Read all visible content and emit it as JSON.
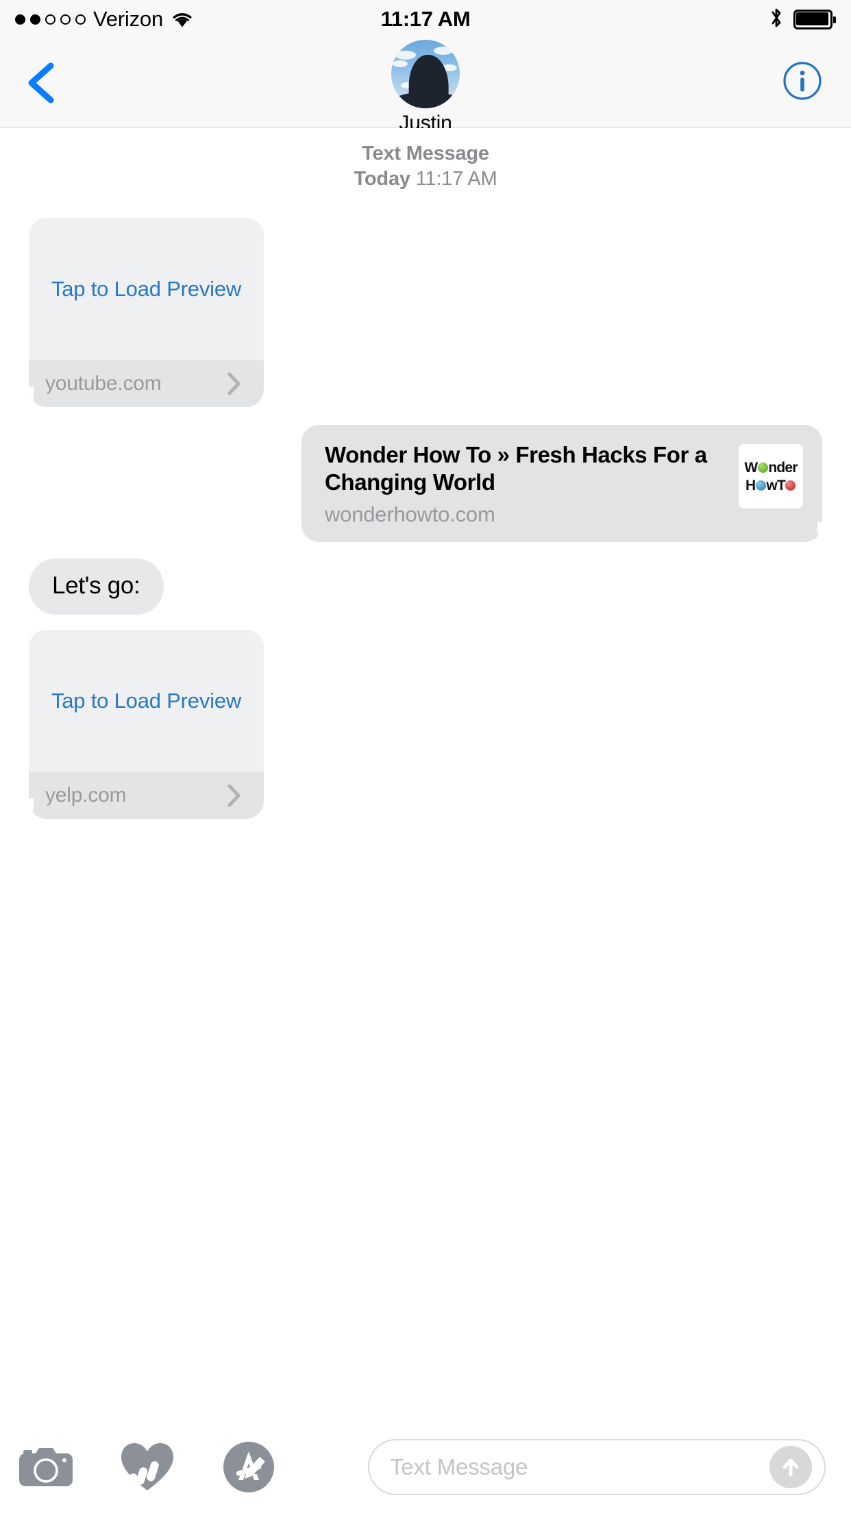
{
  "status_bar": {
    "signal_dots_filled": 2,
    "signal_dots_total": 5,
    "carrier": "Verizon",
    "wifi_icon": "wifi-icon",
    "time": "11:17 AM",
    "bluetooth_icon": "bluetooth-icon",
    "battery_icon": "battery-full-icon",
    "battery_level_pct": 100
  },
  "nav_bar": {
    "back_icon": "chevron-left-icon",
    "contact_name": "Justin",
    "avatar_alt": "contact-avatar",
    "info_icon": "info-circle-icon",
    "accent_color": "#0a7cff"
  },
  "conversation": {
    "timestamp": {
      "service": "Text Message",
      "day": "Today",
      "time": "11:17 AM"
    },
    "messages": [
      {
        "id": "msg-1",
        "type": "link-preview",
        "side": "received",
        "tap_label": "Tap to Load Preview",
        "domain": "youtube.com",
        "chevron_icon": "chevron-right-icon"
      },
      {
        "id": "msg-2",
        "type": "rich-link",
        "side": "sent",
        "title": "Wonder How To » Fresh Hacks For a Changing World",
        "domain": "wonderhowto.com",
        "thumbnail": {
          "alt": "wonderhowto-logo",
          "line1_pre": "W",
          "line1_post": "nder",
          "line2_pre": "H",
          "line2_mid": "wT",
          "ball1_color": "#4fa51c",
          "ball2_color": "#1b76b8",
          "ball3_color": "#c21b18"
        }
      },
      {
        "id": "msg-3",
        "type": "text",
        "side": "received",
        "text": "Let's go:"
      },
      {
        "id": "msg-4",
        "type": "link-preview",
        "side": "received",
        "tap_label": "Tap to Load Preview",
        "domain": "yelp.com",
        "chevron_icon": "chevron-right-icon"
      }
    ]
  },
  "toolbar": {
    "camera_icon": "camera-icon",
    "digital_touch_icon": "digital-touch-heart-icon",
    "app_store_icon": "imessage-apps-icon",
    "input_placeholder": "Text Message",
    "input_value": "",
    "send_icon": "send-arrow-up-icon"
  },
  "colors": {
    "accent_blue": "#0a7cff",
    "link_blue": "#2878c8",
    "bubble_gray": "#e2e3e5",
    "preview_gray": "#eff0f2",
    "muted_text": "#9a9a9e",
    "chrome_bg": "#f8f8f8"
  }
}
